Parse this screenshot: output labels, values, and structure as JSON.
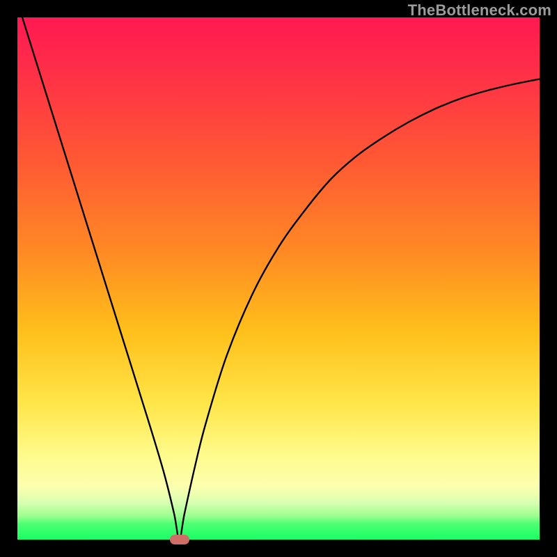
{
  "watermark": "TheBottleneck.com",
  "colors": {
    "gradient_top": "#ff1952",
    "gradient_mid": "#ffbf1a",
    "gradient_bottom": "#19ff66",
    "curve": "#000000",
    "marker": "#cf6e67",
    "background": "#000000"
  },
  "chart_data": {
    "type": "line",
    "title": "",
    "xlabel": "",
    "ylabel": "",
    "xlim": [
      0,
      100
    ],
    "ylim": [
      0,
      100
    ],
    "grid": false,
    "legend": false,
    "annotations": [
      {
        "name": "marker-min",
        "shape": "rounded-rect",
        "x": 31,
        "y": 0
      }
    ],
    "series": [
      {
        "name": "bottleneck-curve",
        "x": [
          0,
          5,
          10,
          15,
          20,
          25,
          28,
          30,
          31,
          32,
          34,
          36,
          40,
          45,
          50,
          55,
          60,
          65,
          70,
          75,
          80,
          85,
          90,
          95,
          100
        ],
        "values": [
          103,
          87,
          71,
          55,
          39,
          23,
          13,
          5,
          0,
          5,
          14,
          22,
          35,
          47,
          56,
          63,
          69,
          73.5,
          77,
          80,
          82.5,
          84.5,
          86,
          87.2,
          88.2
        ]
      }
    ]
  }
}
